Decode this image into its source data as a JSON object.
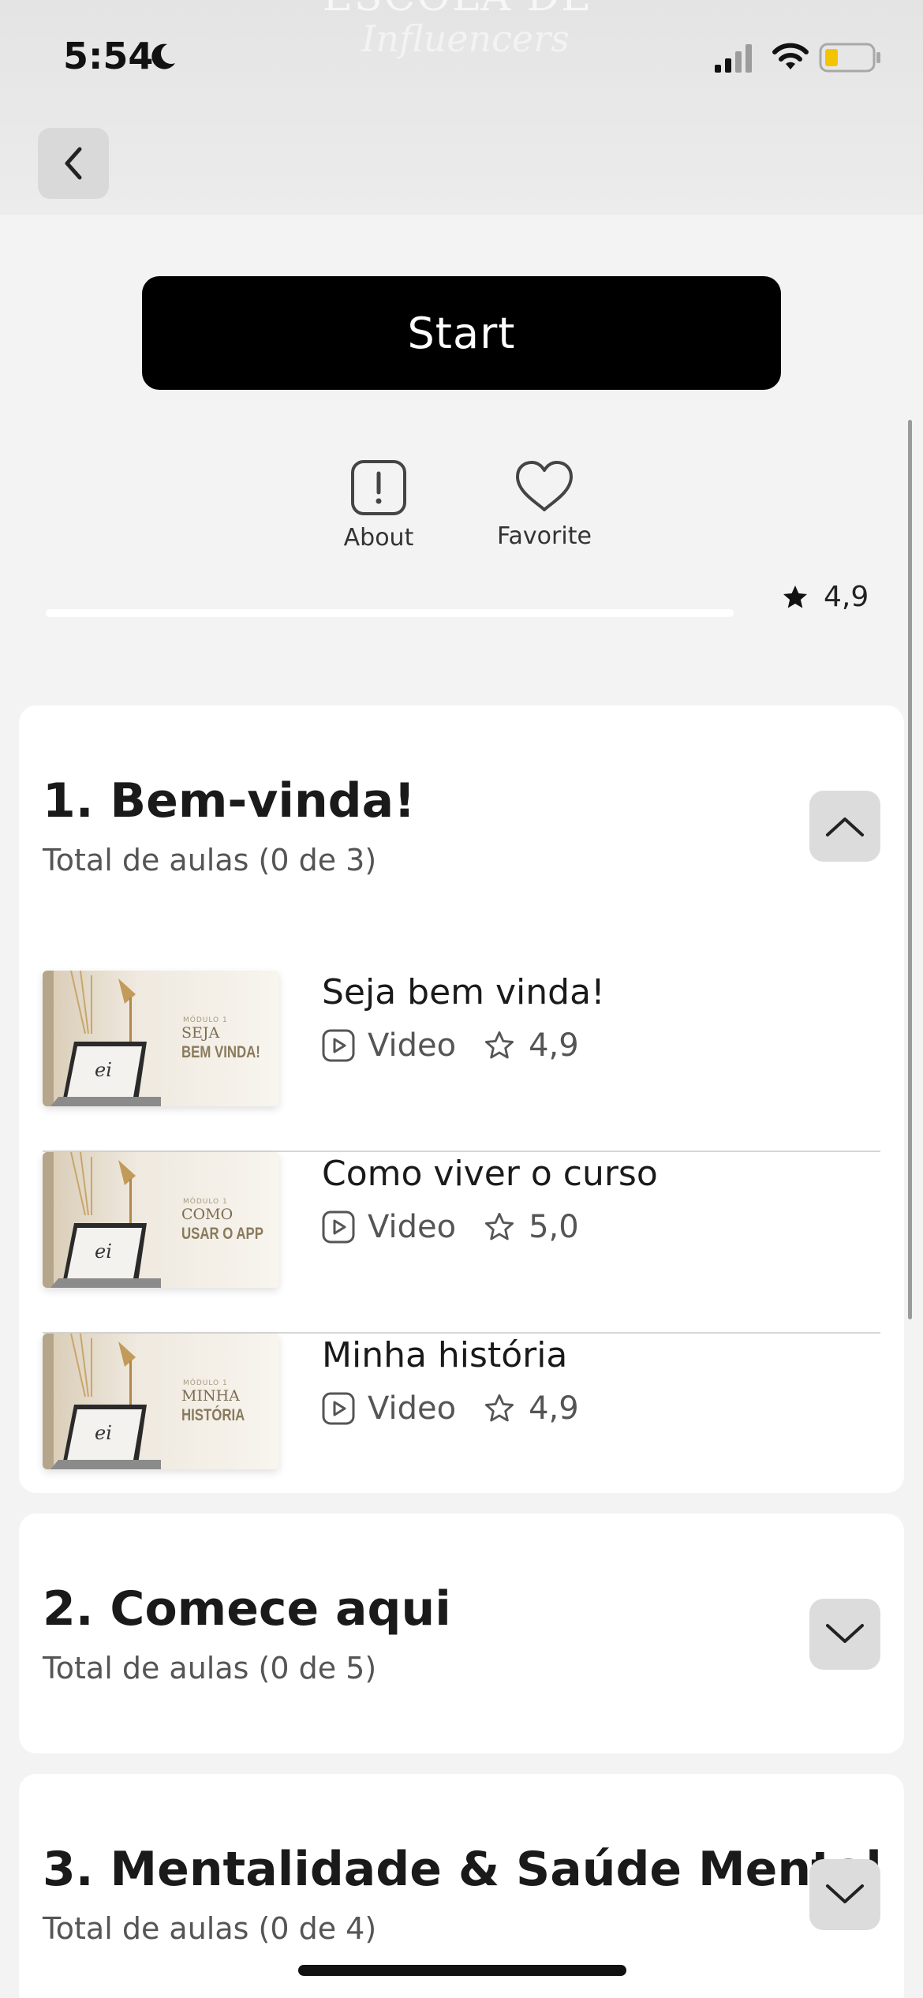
{
  "status_bar": {
    "time": "5:54",
    "icons": [
      "moon-icon",
      "cellular-signal-icon",
      "wifi-icon",
      "battery-icon"
    ]
  },
  "background": {
    "title_line1": "ESCOLA DE",
    "title_line2": "Influencers"
  },
  "nav": {
    "back_icon": "chevron-left-icon"
  },
  "start_button": {
    "label": "Start"
  },
  "actions": [
    {
      "label": "About",
      "icon": "info-alert-icon"
    },
    {
      "label": "Favorite",
      "icon": "heart-icon"
    }
  ],
  "course_rating": "4,9",
  "modules": [
    {
      "title": "1. Bem-vinda!",
      "subtitle": "Total de aulas (0 de 3)",
      "expanded": true,
      "lessons": [
        {
          "title": "Seja bem vinda!",
          "type": "Video",
          "rating": "4,9",
          "thumb": {
            "small": "MÓDULO 1",
            "line1": "SEJA",
            "line2": "BEM VINDA!"
          }
        },
        {
          "title": "Como viver o curso",
          "type": "Video",
          "rating": "5,0",
          "thumb": {
            "small": "MÓDULO 1",
            "line1": "COMO",
            "line2": "USAR O APP"
          }
        },
        {
          "title": "Minha história",
          "type": "Video",
          "rating": "4,9",
          "thumb": {
            "small": "MÓDULO 1",
            "line1": "MINHA",
            "line2": "HISTÓRIA"
          }
        }
      ]
    },
    {
      "title": "2. Comece aqui",
      "subtitle": "Total de aulas (0 de 5)",
      "expanded": false
    },
    {
      "title": "3. Mentalidade & Saúde Mental",
      "subtitle": "Total de aulas (0 de 4)",
      "expanded": false
    }
  ],
  "thumb_logo": "ei",
  "colors": {
    "primary_button": "#000000",
    "card": "#ffffff",
    "background": "#f3f3f3"
  }
}
